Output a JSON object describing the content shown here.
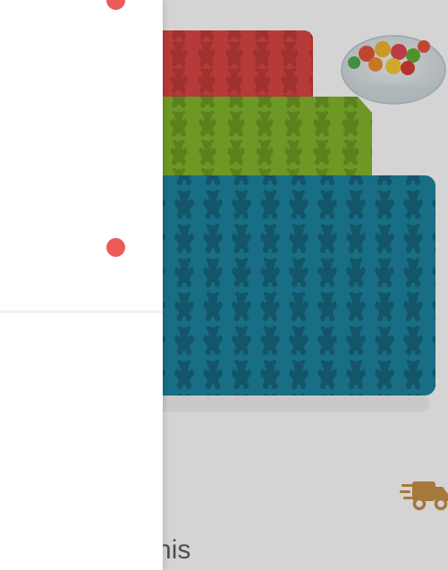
{
  "product": {
    "image_name": "gummy-bear-silicone-molds",
    "caption_fragment": "t this"
  },
  "delivery": {
    "icon": "delivery-truck-icon",
    "color": "#c58a3b"
  },
  "drawer": {
    "indicator_color": "#ec5a5a",
    "items": [
      {
        "icon": "indicator-dot"
      },
      {
        "icon": "indicator-dot"
      }
    ]
  },
  "colors": {
    "mold_red": "#d93a36",
    "mold_green": "#7db21f",
    "mold_blue": "#0f7e9a"
  }
}
